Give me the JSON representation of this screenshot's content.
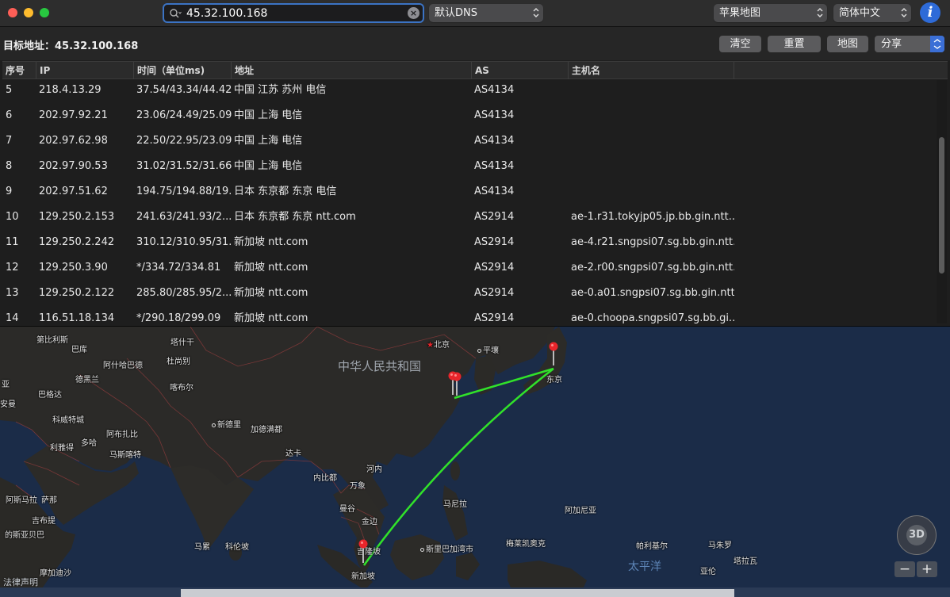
{
  "toolbar": {
    "search_value": "45.32.100.168",
    "dns_select": "默认DNS",
    "map_provider_select": "苹果地图",
    "language_select": "简体中文",
    "info_icon": "i"
  },
  "target": {
    "label": "目标地址：45.32.100.168",
    "buttons": {
      "clear": "清空",
      "reset": "重置",
      "map": "地图",
      "share": "分享"
    }
  },
  "table": {
    "headers": {
      "no": "序号",
      "ip": "IP",
      "time": "时间（单位ms)",
      "addr": "地址",
      "as": "AS",
      "host": "主机名"
    },
    "rows": [
      {
        "no": "5",
        "ip": "218.4.13.29",
        "time": "37.54/43.34/44.42",
        "addr": "中国 江苏 苏州 电信",
        "as": "AS4134",
        "host": ""
      },
      {
        "no": "6",
        "ip": "202.97.92.21",
        "time": "23.06/24.49/25.09",
        "addr": "中国 上海 电信",
        "as": "AS4134",
        "host": ""
      },
      {
        "no": "7",
        "ip": "202.97.62.98",
        "time": "22.50/22.95/23.09",
        "addr": "中国 上海 电信",
        "as": "AS4134",
        "host": ""
      },
      {
        "no": "8",
        "ip": "202.97.90.53",
        "time": "31.02/31.52/31.66",
        "addr": "中国 上海 电信",
        "as": "AS4134",
        "host": ""
      },
      {
        "no": "9",
        "ip": "202.97.51.62",
        "time": "194.75/194.88/19...",
        "addr": "日本 东京都 东京 电信",
        "as": "AS4134",
        "host": ""
      },
      {
        "no": "10",
        "ip": "129.250.2.153",
        "time": "241.63/241.93/2...",
        "addr": "日本 东京都 东京 ntt.com",
        "as": "AS2914",
        "host": "ae-1.r31.tokyjp05.jp.bb.gin.ntt...."
      },
      {
        "no": "11",
        "ip": "129.250.2.242",
        "time": "310.12/310.95/31...",
        "addr": "新加坡 ntt.com",
        "as": "AS2914",
        "host": "ae-4.r21.sngpsi07.sg.bb.gin.ntt..."
      },
      {
        "no": "12",
        "ip": "129.250.3.90",
        "time": "*/334.72/334.81",
        "addr": "新加坡 ntt.com",
        "as": "AS2914",
        "host": "ae-2.r00.sngpsi07.sg.bb.gin.ntt..."
      },
      {
        "no": "13",
        "ip": "129.250.2.122",
        "time": "285.80/285.95/2...",
        "addr": "新加坡 ntt.com",
        "as": "AS2914",
        "host": "ae-0.a01.sngpsi07.sg.bb.gin.ntt..."
      },
      {
        "no": "14",
        "ip": "116.51.18.134",
        "time": "*/290.18/299.09",
        "addr": "新加坡 ntt.com",
        "as": "AS2914",
        "host": "ae-0.choopa.sngpsi07.sg.bb.gi..."
      }
    ]
  },
  "map": {
    "labels": {
      "china": "中华人民共和国",
      "beijing": "北京",
      "pyongyang": "平壤",
      "tokyo": "东京",
      "bishkek": "第比利斯",
      "baku": "巴库",
      "tashkent": "塔什干",
      "ashgabat": "阿什哈巴德",
      "dushanbe": "杜尚别",
      "tehran": "德黑兰",
      "kabul": "喀布尔",
      "baghdad": "巴格达",
      "kuwait": "科威特城",
      "riyadh": "利雅得",
      "doha": "多哈",
      "abudhabi": "阿布扎比",
      "muscat": "马斯喀特",
      "newdelhi": "新德里",
      "kathmandu": "加德满都",
      "dhaka": "达卡",
      "naypyidaw": "内比都",
      "hanoi": "河内",
      "vientiane": "万象",
      "bangkok": "曼谷",
      "phnompenh": "金边",
      "manila": "马尼拉",
      "agana": "阿加尼亚",
      "male": "马累",
      "colombo": "科伦坡",
      "kualalumpur": "吉隆坡",
      "singapore": "新加坡",
      "bandar": "斯里巴加湾市",
      "melekeok": "梅莱凯奥克",
      "palikir": "帕利基尔",
      "majuro": "马朱罗",
      "tarawa": "塔拉瓦",
      "yaren": "亚伦",
      "pacific": "太平洋",
      "asmara": "阿斯马拉",
      "sanaa": "萨那",
      "djibouti": "吉布提",
      "addis": "的斯亚贝巴",
      "mogadishu": "摩加迪沙",
      "asia": "亚",
      "anan": "安曼"
    },
    "legal": "法律声明",
    "compass_label": "3D",
    "zoom_out": "−",
    "zoom_in": "+",
    "route_color": "#31e22a",
    "pin_color": "#e8252b"
  }
}
